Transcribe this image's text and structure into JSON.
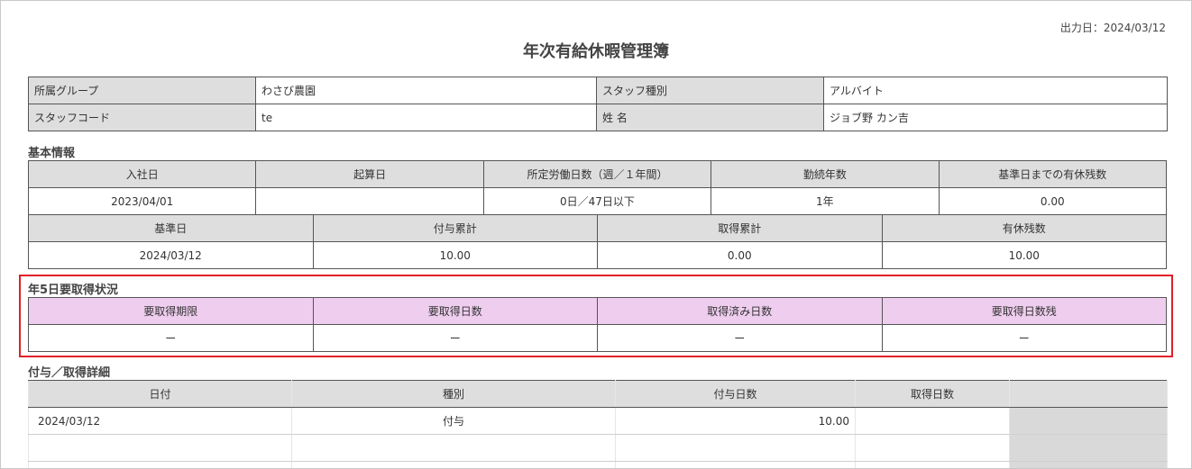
{
  "header": {
    "output_date_label": "出力日：",
    "output_date": "2024/03/12",
    "title": "年次有給休暇管理簿"
  },
  "staff": {
    "group_label": "所属グループ",
    "group_value": "わさび農園",
    "type_label": "スタッフ種別",
    "type_value": "アルバイト",
    "code_label": "スタッフコード",
    "code_value": "te",
    "name_label": "姓 名",
    "name_value": "ジョブ野 カン吉"
  },
  "basic": {
    "section_title": "基本情報",
    "row1_headers": [
      "入社日",
      "起算日",
      "所定労働日数（週／１年間）",
      "勤続年数",
      "基準日までの有休残数"
    ],
    "row1_values": [
      "2023/04/01",
      "",
      "0日／47日以下",
      "1年",
      "0.00"
    ],
    "row2_headers": [
      "基準日",
      "付与累計",
      "取得累計",
      "有休残数"
    ],
    "row2_values": [
      "2024/03/12",
      "10.00",
      "0.00",
      "10.00"
    ]
  },
  "five_day": {
    "section_title": "年5日要取得状況",
    "headers": [
      "要取得期限",
      "要取得日数",
      "取得済み日数",
      "要取得日数残"
    ],
    "values": [
      "ー",
      "ー",
      "ー",
      "ー"
    ],
    "highlight_color": "#e0202a",
    "header_color": "#eecdee"
  },
  "detail": {
    "section_title": "付与／取得詳細",
    "headers": [
      "日付",
      "種別",
      "付与日数",
      "取得日数",
      ""
    ],
    "rows": [
      [
        "2024/03/12",
        "付与",
        "10.00",
        ""
      ],
      [
        "",
        "",
        "",
        ""
      ],
      [
        "",
        "",
        "",
        ""
      ]
    ]
  }
}
